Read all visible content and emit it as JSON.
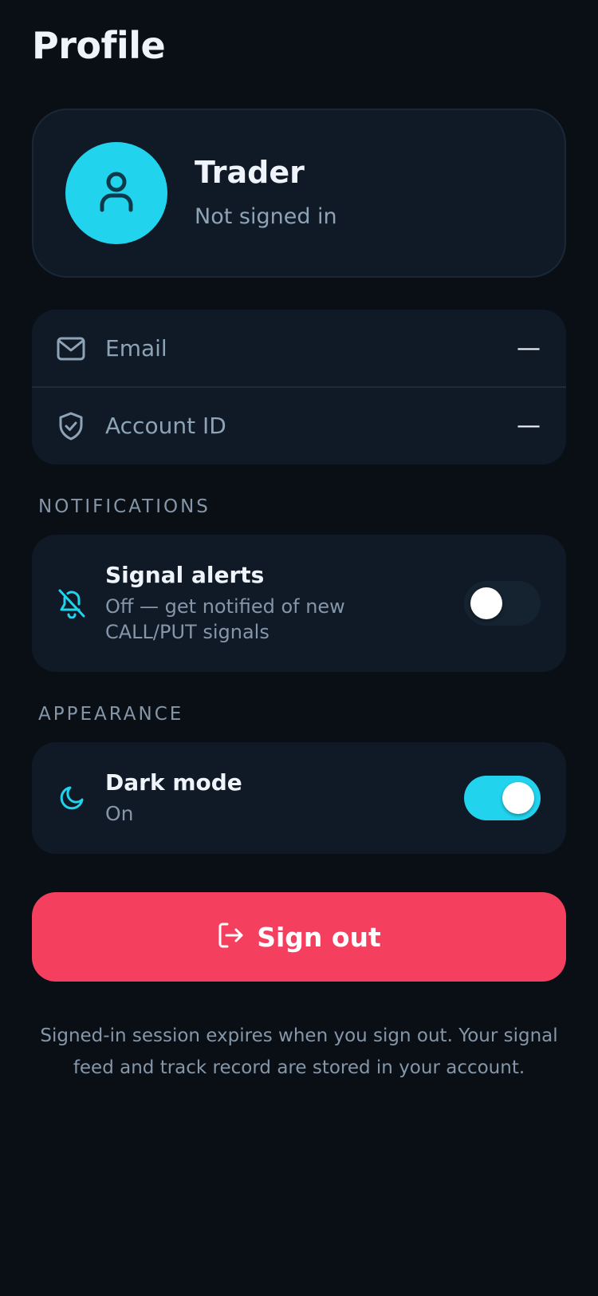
{
  "page": {
    "title": "Profile"
  },
  "profile": {
    "name": "Trader",
    "status": "Not signed in",
    "avatar_icon": "user-icon",
    "avatar_color": "#22d3ee"
  },
  "account": {
    "rows": [
      {
        "label": "Email",
        "value": "—",
        "icon": "mail-icon"
      },
      {
        "label": "Account ID",
        "value": "—",
        "icon": "shield-check-icon"
      }
    ]
  },
  "notifications": {
    "section_label": "NOTIFICATIONS",
    "signal_alerts": {
      "title": "Signal alerts",
      "description": "Off — get notified of new CALL/PUT signals",
      "icon": "bell-off-icon",
      "enabled": false
    }
  },
  "appearance": {
    "section_label": "APPEARANCE",
    "dark_mode": {
      "title": "Dark mode",
      "description": "On",
      "icon": "moon-icon",
      "enabled": true
    }
  },
  "actions": {
    "sign_out_label": "Sign out",
    "sign_out_icon": "log-out-icon",
    "sign_out_color": "#f43f5e"
  },
  "footer": {
    "note": "Signed-in session expires when you sign out. Your signal feed and track record are stored in your account."
  },
  "colors": {
    "accent": "#22d3ee",
    "background": "#0a0f16",
    "card": "#0f1a26",
    "danger": "#f43f5e"
  }
}
